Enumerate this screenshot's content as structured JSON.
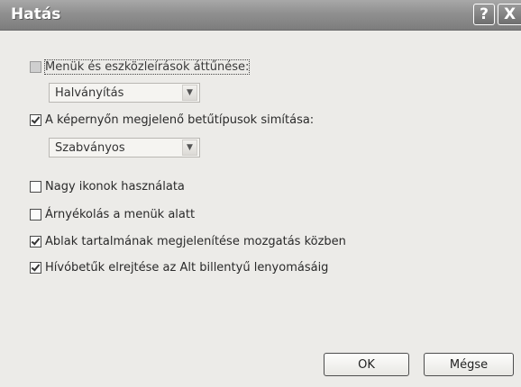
{
  "window": {
    "title": "Hatás",
    "help_glyph": "?",
    "close_glyph": "X"
  },
  "options": {
    "fade": {
      "label": "Menük és eszközleírások áttűnése:",
      "checked": false,
      "enabled": false,
      "effect": "Halványítás"
    },
    "smoothing": {
      "label": "A képernyőn megjelenő betűtípusok simítása:",
      "checked": true,
      "method": "Szabványos"
    },
    "large_icons": {
      "label": "Nagy ikonok használata",
      "checked": false
    },
    "menu_shadow": {
      "label": "Árnyékolás a menük alatt",
      "checked": false
    },
    "drag_contents": {
      "label": "Ablak tartalmának megjelenítése mozgatás közben",
      "checked": true
    },
    "hide_underlines": {
      "label": "Hívóbetűk elrejtése az Alt billentyű lenyomásáig",
      "checked": true
    }
  },
  "buttons": {
    "ok": "OK",
    "cancel": "Mégse"
  }
}
